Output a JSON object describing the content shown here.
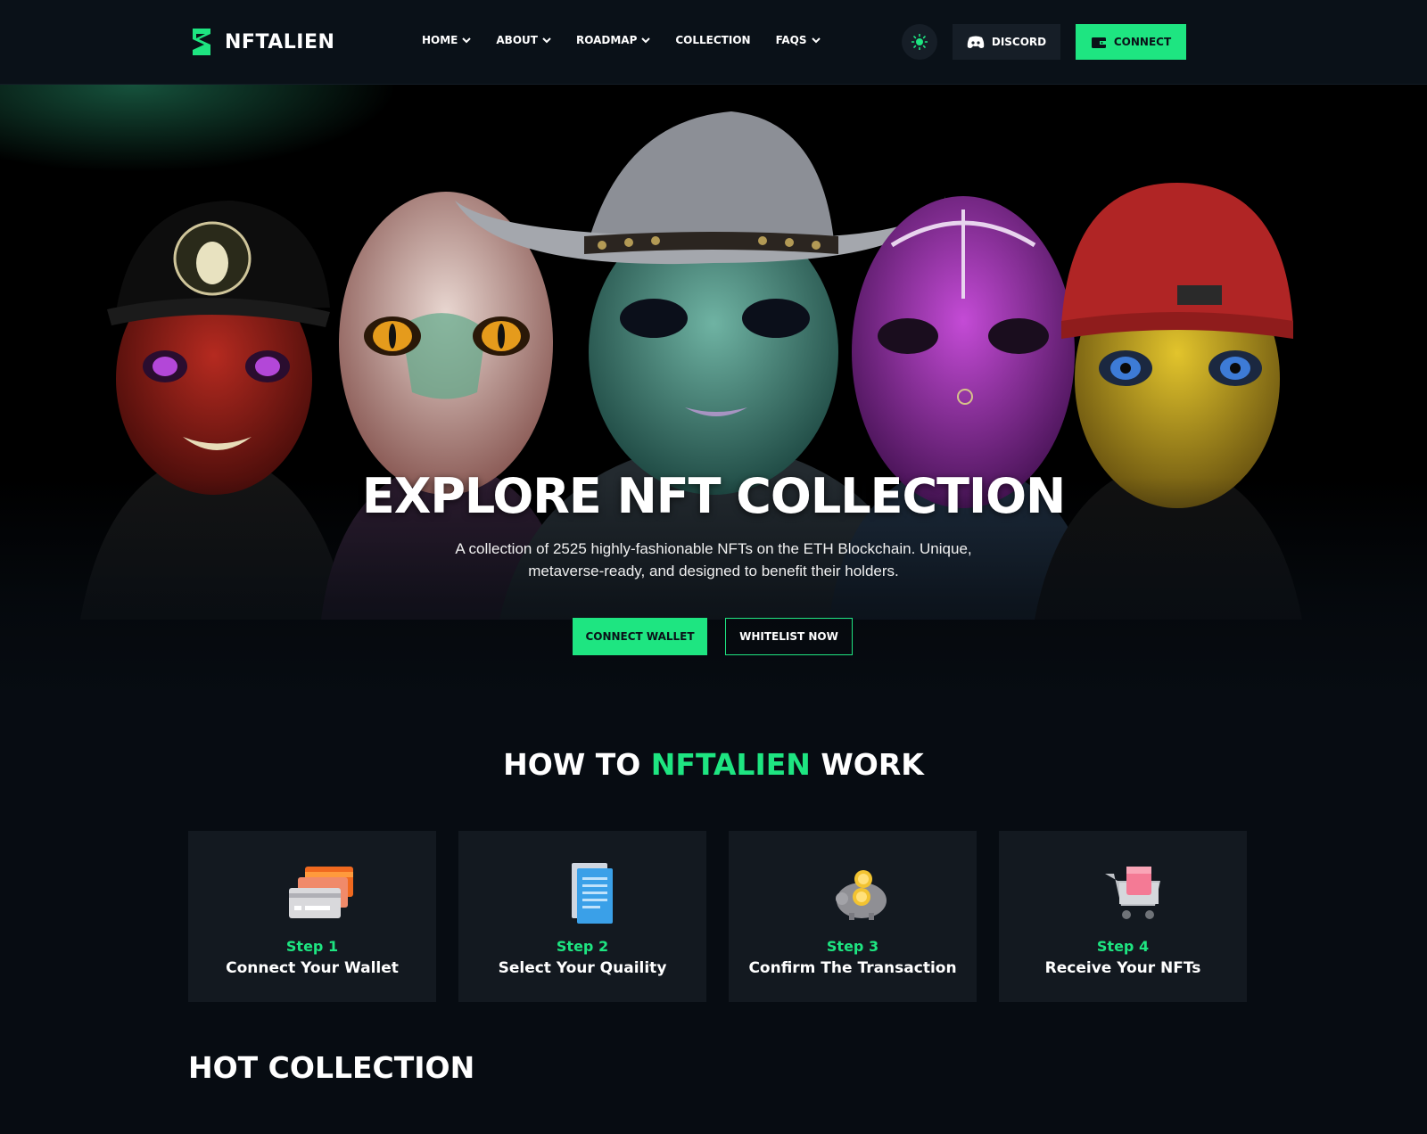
{
  "brand": {
    "name": "NFTALIEN"
  },
  "nav": {
    "items": [
      {
        "label": "HOME",
        "has_dropdown": true
      },
      {
        "label": "ABOUT",
        "has_dropdown": true
      },
      {
        "label": "ROADMAP",
        "has_dropdown": true
      },
      {
        "label": "COLLECTION",
        "has_dropdown": false
      },
      {
        "label": "FAQS",
        "has_dropdown": true
      }
    ],
    "theme_icon": "sun-icon",
    "discord_label": "DISCORD",
    "connect_label": "CONNECT"
  },
  "hero": {
    "title": "EXPLORE NFT COLLECTION",
    "subtitle": "A collection of 2525 highly-fashionable NFTs on the ETH Blockchain. Unique, metaverse-ready, and designed to benefit their holders.",
    "connect_wallet_label": "CONNECT WALLET",
    "whitelist_label": "WHITELIST NOW"
  },
  "how": {
    "title_pre": "HOW TO ",
    "title_accent": "NFTALIEN",
    "title_post": " WORK",
    "steps": [
      {
        "step": "Step 1",
        "label": "Connect Your Wallet",
        "icon": "wallet-cards-icon"
      },
      {
        "step": "Step 2",
        "label": "Select Your Quaility",
        "icon": "document-icon"
      },
      {
        "step": "Step 3",
        "label": "Confirm The Transaction",
        "icon": "piggy-bank-icon"
      },
      {
        "step": "Step 4",
        "label": "Receive Your NFTs",
        "icon": "shopping-cart-icon"
      }
    ]
  },
  "hot_collection": {
    "title": "HOT COLLECTION"
  },
  "colors": {
    "accent": "#1ee581",
    "background": "#070c12",
    "card": "#131920"
  }
}
